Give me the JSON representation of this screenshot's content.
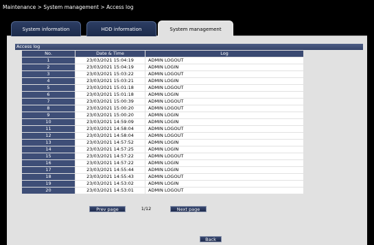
{
  "breadcrumb": "Maintenance > System management > Access log",
  "tabs": [
    {
      "label": "System information",
      "active": false
    },
    {
      "label": "HDD information",
      "active": false
    },
    {
      "label": "System management",
      "active": true
    }
  ],
  "section_title": "Access log",
  "table": {
    "headers": [
      "No.",
      "Date & Time",
      "Log"
    ],
    "rows": [
      {
        "no": "1",
        "datetime": "23/03/2021 15:04:19",
        "log": "ADMIN LOGOUT"
      },
      {
        "no": "2",
        "datetime": "23/03/2021 15:04:19",
        "log": "ADMIN LOGIN"
      },
      {
        "no": "3",
        "datetime": "23/03/2021 15:03:22",
        "log": "ADMIN LOGOUT"
      },
      {
        "no": "4",
        "datetime": "23/03/2021 15:03:21",
        "log": "ADMIN LOGIN"
      },
      {
        "no": "5",
        "datetime": "23/03/2021 15:01:18",
        "log": "ADMIN LOGOUT"
      },
      {
        "no": "6",
        "datetime": "23/03/2021 15:01:18",
        "log": "ADMIN LOGIN"
      },
      {
        "no": "7",
        "datetime": "23/03/2021 15:00:39",
        "log": "ADMIN LOGOUT"
      },
      {
        "no": "8",
        "datetime": "23/03/2021 15:00:20",
        "log": "ADMIN LOGOUT"
      },
      {
        "no": "9",
        "datetime": "23/03/2021 15:00:20",
        "log": "ADMIN LOGIN"
      },
      {
        "no": "10",
        "datetime": "23/03/2021 14:59:09",
        "log": "ADMIN LOGIN"
      },
      {
        "no": "11",
        "datetime": "23/03/2021 14:58:04",
        "log": "ADMIN LOGOUT"
      },
      {
        "no": "12",
        "datetime": "23/03/2021 14:58:04",
        "log": "ADMIN LOGOUT"
      },
      {
        "no": "13",
        "datetime": "23/03/2021 14:57:52",
        "log": "ADMIN LOGIN"
      },
      {
        "no": "14",
        "datetime": "23/03/2021 14:57:25",
        "log": "ADMIN LOGIN"
      },
      {
        "no": "15",
        "datetime": "23/03/2021 14:57:22",
        "log": "ADMIN LOGOUT"
      },
      {
        "no": "16",
        "datetime": "23/03/2021 14:57:22",
        "log": "ADMIN LOGIN"
      },
      {
        "no": "17",
        "datetime": "23/03/2021 14:55:44",
        "log": "ADMIN LOGIN"
      },
      {
        "no": "18",
        "datetime": "23/03/2021 14:55:43",
        "log": "ADMIN LOGOUT"
      },
      {
        "no": "19",
        "datetime": "23/03/2021 14:53:02",
        "log": "ADMIN LOGIN"
      },
      {
        "no": "20",
        "datetime": "23/03/2021 14:53:01",
        "log": "ADMIN LOGOUT"
      }
    ]
  },
  "pagination": {
    "prev_label": "Prev page",
    "page_indicator": "1/12",
    "next_label": "Next page"
  },
  "back_label": "Back"
}
